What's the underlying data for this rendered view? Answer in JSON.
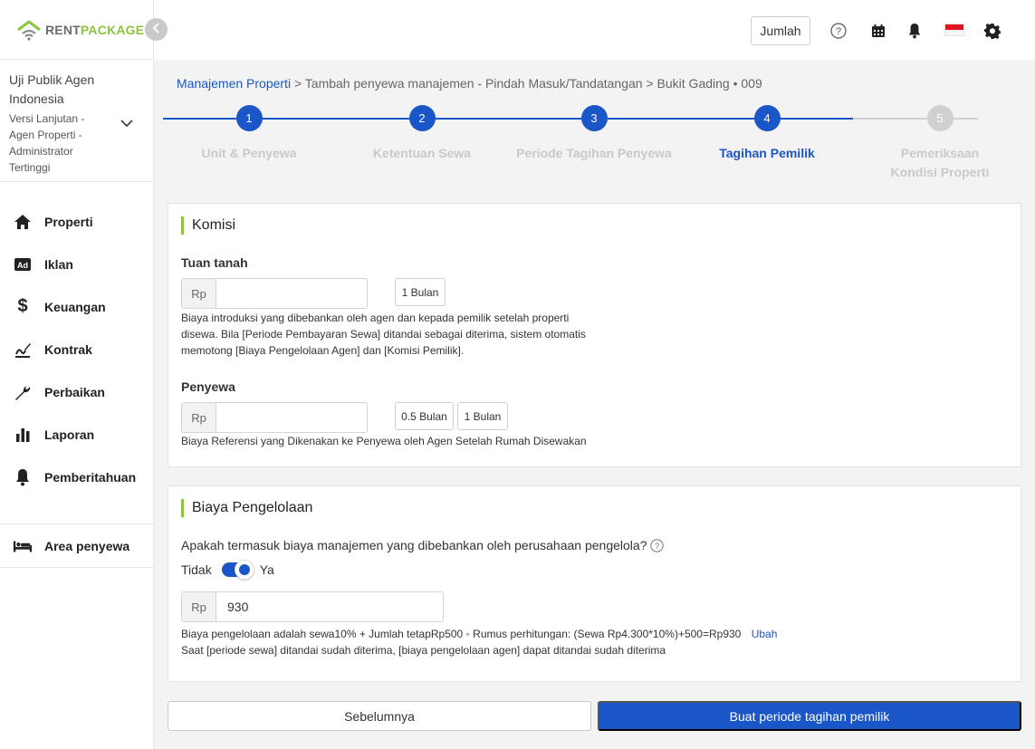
{
  "brand": {
    "rent": "RENT",
    "package": "PACKAGE"
  },
  "user": {
    "name": "Uji Publik Agen Indonesia",
    "role": "Versi Lanjutan - Agen Properti - Administrator Tertinggi"
  },
  "nav": [
    {
      "label": "Properti",
      "icon": "house-icon"
    },
    {
      "label": "Iklan",
      "icon": "ad-icon"
    },
    {
      "label": "Keuangan",
      "icon": "dollar-icon"
    },
    {
      "label": "Kontrak",
      "icon": "contract-sign-icon"
    },
    {
      "label": "Perbaikan",
      "icon": "wrench-icon"
    },
    {
      "label": "Laporan",
      "icon": "bar-chart-icon"
    },
    {
      "label": "Pemberitahuan",
      "icon": "bell-icon"
    }
  ],
  "tenant_area": {
    "label": "Area penyewa",
    "icon": "bed-icon"
  },
  "topbar": {
    "jumlah_label": "Jumlah"
  },
  "breadcrumb": {
    "root": "Manajemen Properti",
    "separator": ">",
    "middle": "Tambah penyewa manajemen - Pindah Masuk/Tandatangan",
    "current": "Bukit Gading • 009"
  },
  "steps": [
    {
      "number": "1",
      "label": "Unit & Penyewa",
      "state": "done"
    },
    {
      "number": "2",
      "label": "Ketentuan Sewa",
      "state": "done"
    },
    {
      "number": "3",
      "label": "Periode Tagihan Penyewa",
      "state": "done"
    },
    {
      "number": "4",
      "label": "Tagihan Pemilik",
      "state": "active"
    },
    {
      "number": "5",
      "label": "Pemeriksaan Kondisi Properti",
      "state": "pending"
    }
  ],
  "komisi": {
    "title": "Komisi",
    "landlord": {
      "label": "Tuan tanah",
      "currency": "Rp",
      "value": "",
      "chips": [
        "1 Bulan"
      ],
      "help": "Biaya introduksi yang dibebankan oleh agen dan kepada pemilik setelah properti disewa. Bila [Periode Pembayaran Sewa] ditandai sebagai diterima, sistem otomatis memotong [Biaya Pengelolaan Agen] dan [Komisi Pemilik]."
    },
    "tenant": {
      "label": "Penyewa",
      "currency": "Rp",
      "value": "",
      "chips": [
        "0.5 Bulan",
        "1 Bulan"
      ],
      "help": "Biaya Referensi yang Dikenakan ke Penyewa oleh Agen Setelah Rumah Disewakan"
    }
  },
  "management_fee": {
    "title": "Biaya Pengelolaan",
    "question": "Apakah termasuk biaya manajemen yang dibebankan oleh perusahaan pengelola?",
    "toggle_off": "Tidak",
    "toggle_on": "Ya",
    "toggle_value": true,
    "currency": "Rp",
    "value": "930",
    "formula": "Biaya pengelolaan adalah sewa10% + Jumlah tetapRp500 ◦ Rumus perhitungan: (Sewa Rp4.300*10%)+500=Rp930",
    "change_link": "Ubah",
    "note": "Saat [periode sewa] ditandai sudah diterima, [biaya pengelolaan agen] dapat ditandai sudah diterima"
  },
  "actions": {
    "prev": "Sebelumnya",
    "create": "Buat periode tagihan pemilik"
  },
  "colors": {
    "primary": "#1a56c8",
    "brand_green": "#8cc63f",
    "step_pending": "#d0d0d0"
  }
}
